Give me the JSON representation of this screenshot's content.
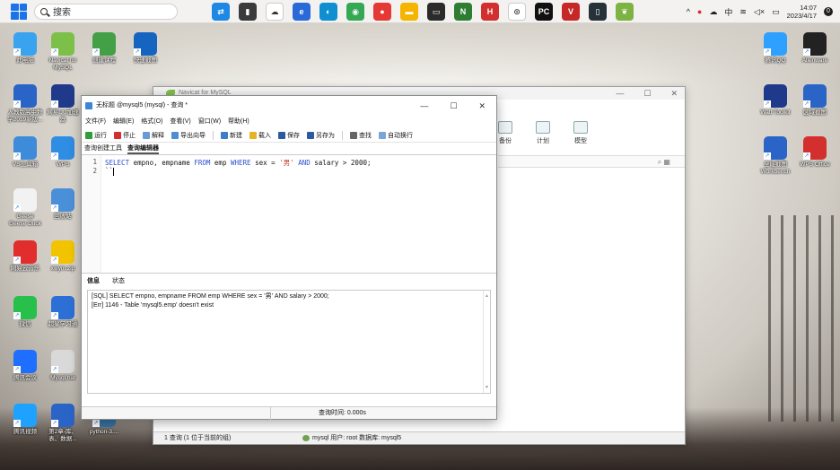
{
  "taskbar": {
    "search_label": "搜索",
    "clock_time": "14:07",
    "clock_date": "2023/4/17",
    "ime_label": "中",
    "notif_count": "0",
    "apps": [
      {
        "name": "remote-app",
        "color": "#1e88e5",
        "glyph": "⇄"
      },
      {
        "name": "dark-app",
        "color": "#3b3b3b",
        "glyph": "▮"
      },
      {
        "name": "weather-app",
        "color": "#ffffff",
        "glyph": "☁"
      },
      {
        "name": "edge-blue-app",
        "color": "#2a6ad8",
        "glyph": "e"
      },
      {
        "name": "edge-app",
        "color": "#0f8fd0",
        "glyph": "◐"
      },
      {
        "name": "chrome-app",
        "color": "#34a853",
        "glyph": "◉"
      },
      {
        "name": "user-app",
        "color": "#e53935",
        "glyph": "●"
      },
      {
        "name": "folder-app",
        "color": "#f4b400",
        "glyph": "▬"
      },
      {
        "name": "terminal-app",
        "color": "#2b2b2b",
        "glyph": "▭"
      },
      {
        "name": "navicat-app",
        "color": "#2e7d32",
        "glyph": "N"
      },
      {
        "name": "h-app",
        "color": "#d32f2f",
        "glyph": "H"
      },
      {
        "name": "swirl-app",
        "color": "#ffffff",
        "glyph": "⊙"
      },
      {
        "name": "pycharm-app",
        "color": "#111111",
        "glyph": "PC"
      },
      {
        "name": "vs-app",
        "color": "#c62828",
        "glyph": "V"
      },
      {
        "name": "monitor-app",
        "color": "#263238",
        "glyph": "▯"
      },
      {
        "name": "leaf-app",
        "color": "#7cb342",
        "glyph": "❦"
      }
    ]
  },
  "desktop_icons": [
    {
      "label": "此电脑",
      "color": "#3aa3f0"
    },
    {
      "label": "Navicat for MySQL",
      "color": "#7cc04a"
    },
    {
      "label": "创建课程",
      "color": "#43a047"
    },
    {
      "label": "快速截图",
      "color": "#1565c0"
    },
    {
      "label": "人教版高中数学2019新版...",
      "color": "#2b64c7"
    },
    {
      "label": "网易UU加速器",
      "color": "#1f3a8a"
    },
    {
      "label": "VS工具箱",
      "color": "#3d8bd9"
    },
    {
      "label": "WPS",
      "color": "#2f8de4"
    },
    {
      "label": "Geese Geese Duck",
      "color": "#f2f2f2"
    },
    {
      "label": "回收站",
      "color": "#4a90d9"
    },
    {
      "label": "网易云音乐",
      "color": "#e22d2d"
    },
    {
      "label": "xwym.zip",
      "color": "#f2c400"
    },
    {
      "label": "微信",
      "color": "#27c04a"
    },
    {
      "label": "超星学习通",
      "color": "#2c6fd6"
    },
    {
      "label": "腾讯会议",
      "color": "#1e6fff"
    },
    {
      "label": "Mysql.bat",
      "color": "#d9d9d9"
    },
    {
      "label": "腾讯视频",
      "color": "#1fa2ff"
    },
    {
      "label": "第2章-库、表、数据...",
      "color": "#2b64c7"
    },
    {
      "label": "python-3....",
      "color": "#3572a5"
    },
    {
      "label": "腾讯QQ",
      "color": "#2ea0ff"
    },
    {
      "label": "Alienware",
      "color": "#222222"
    },
    {
      "label": "Watt Toolkit",
      "color": "#1f3a8a"
    },
    {
      "label": "区域截图",
      "color": "#2b64c7"
    },
    {
      "label": "全能截图 Workbench",
      "color": "#2b64c7"
    },
    {
      "label": "WPS Office",
      "color": "#d32f2f"
    },
    {
      "label": "Steam",
      "color": "#1b2838"
    }
  ],
  "navicat_main": {
    "title": "Navicat for MySQL",
    "tools": [
      "备份",
      "计划",
      "模型"
    ],
    "status_left": "1 查询 (1 位于当前的组)",
    "status_right": "mysql  用户: root  数据库: mysql5"
  },
  "query_window": {
    "title": "无标题 @mysql5 (mysql) - 查询 *",
    "menu": [
      "文件(F)",
      "编辑(E)",
      "格式(O)",
      "查看(V)",
      "窗口(W)",
      "帮助(H)"
    ],
    "toolbar": [
      {
        "label": "运行",
        "color": "#2e9d3a"
      },
      {
        "label": "停止",
        "color": "#d32f2f"
      },
      {
        "label": "解释",
        "color": "#6a9bd8"
      },
      {
        "label": "导出向导",
        "color": "#4f8fd1"
      },
      {
        "label": "新建",
        "color": "#3d7cc9"
      },
      {
        "label": "载入",
        "color": "#e6b422"
      },
      {
        "label": "保存",
        "color": "#2c5aa0"
      },
      {
        "label": "另存为",
        "color": "#2c5aa0"
      },
      {
        "label": "查找",
        "color": "#666666"
      },
      {
        "label": "自动换行",
        "color": "#7aa5d8"
      }
    ],
    "tabs": [
      "查询创建工具",
      "查询编辑器"
    ],
    "code_line1_num": "1",
    "code_line2_num": "2",
    "code": {
      "kw_select": "SELECT",
      "cols": " empno, empname ",
      "kw_from": "FROM",
      "table": " emp ",
      "kw_where": "WHERE",
      "cond1": " sex = ",
      "str_val": "'男'",
      "kw_and": " AND",
      "cond2": " salary > 2000;",
      "line2": "``"
    },
    "result_tabs": [
      "信息",
      "状态"
    ],
    "messages": [
      "[SQL] SELECT empno, empname FROM emp WHERE sex = '男' AND salary > 2000;",
      "[Err] 1146 - Table 'mysql5.emp' doesn't exist"
    ],
    "query_time": "查询时间: 0.000s"
  }
}
